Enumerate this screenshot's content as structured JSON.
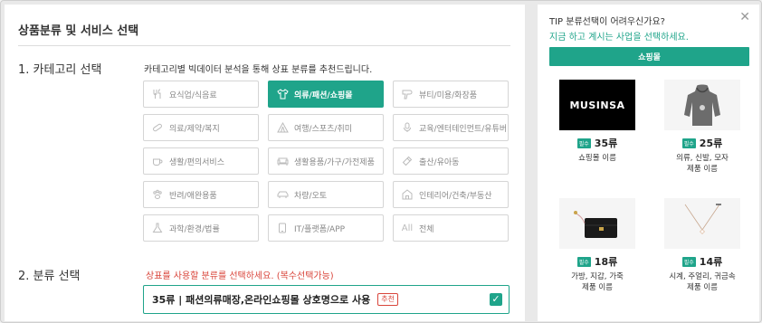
{
  "header": {
    "title": "상품분류 및 서비스 선택"
  },
  "section1": {
    "label": "1. 카테고리 선택",
    "description": "카테고리별 빅데이터 분석을 통해 상표 분류를 추천드립니다."
  },
  "categories": [
    {
      "label": "요식업/식음료",
      "icon": "food-icon",
      "active": false
    },
    {
      "label": "의류/패션/쇼핑몰",
      "icon": "shirt-icon",
      "active": true
    },
    {
      "label": "뷰티/미용/화장품",
      "icon": "hairdryer-icon",
      "active": false
    },
    {
      "label": "의료/제약/복지",
      "icon": "pill-icon",
      "active": false
    },
    {
      "label": "여행/스포츠/취미",
      "icon": "tent-icon",
      "active": false
    },
    {
      "label": "교육/엔터테인먼트/유튜버",
      "icon": "microphone-icon",
      "active": false
    },
    {
      "label": "생활/편의서비스",
      "icon": "cup-icon",
      "active": false
    },
    {
      "label": "생활용품/가구/가전제품",
      "icon": "sofa-icon",
      "active": false
    },
    {
      "label": "출산/유아동",
      "icon": "bottle-icon",
      "active": false
    },
    {
      "label": "반려/애완용품",
      "icon": "paw-icon",
      "active": false
    },
    {
      "label": "차량/오토",
      "icon": "car-icon",
      "active": false
    },
    {
      "label": "인테리어/건축/부동산",
      "icon": "building-icon",
      "active": false
    },
    {
      "label": "과학/환경/법률",
      "icon": "flask-icon",
      "active": false
    },
    {
      "label": "IT/플랫폼/APP",
      "icon": "monitor-icon",
      "active": false
    },
    {
      "label": "전체",
      "icon": "all-icon",
      "active": false
    }
  ],
  "section2": {
    "label": "2. 분류 선택",
    "note": "상표를 사용할 분류를 선택하세요. (복수선택가능)",
    "selected": {
      "text": "35류 | 패션의류매장,온라인쇼핑몰 상호명으로 사용",
      "badge": "추천",
      "checked": true
    }
  },
  "tip": {
    "title": "TIP 분류선택이 어려우신가요?",
    "subtitle": "지금 하고 계시는 사업을 선택하세요.",
    "button": "쇼핑몰",
    "close_icon": "close-icon",
    "cards": [
      {
        "image_text": "MUSINSA",
        "badge": "필수",
        "code": "35류",
        "desc1": "쇼핑몰 이름",
        "desc2": ""
      },
      {
        "image_text": "",
        "badge": "필수",
        "code": "25류",
        "desc1": "의류, 신발, 모자",
        "desc2": "제품 이름"
      },
      {
        "image_text": "",
        "badge": "필수",
        "code": "18류",
        "desc1": "가방, 지갑, 가죽",
        "desc2": "제품 이름"
      },
      {
        "image_text": "",
        "badge": "필수",
        "code": "14류",
        "desc1": "시계, 주얼리, 귀금속",
        "desc2": "제품 이름"
      }
    ]
  },
  "colors": {
    "accent": "#1fa48a",
    "alert": "#d9453b"
  }
}
